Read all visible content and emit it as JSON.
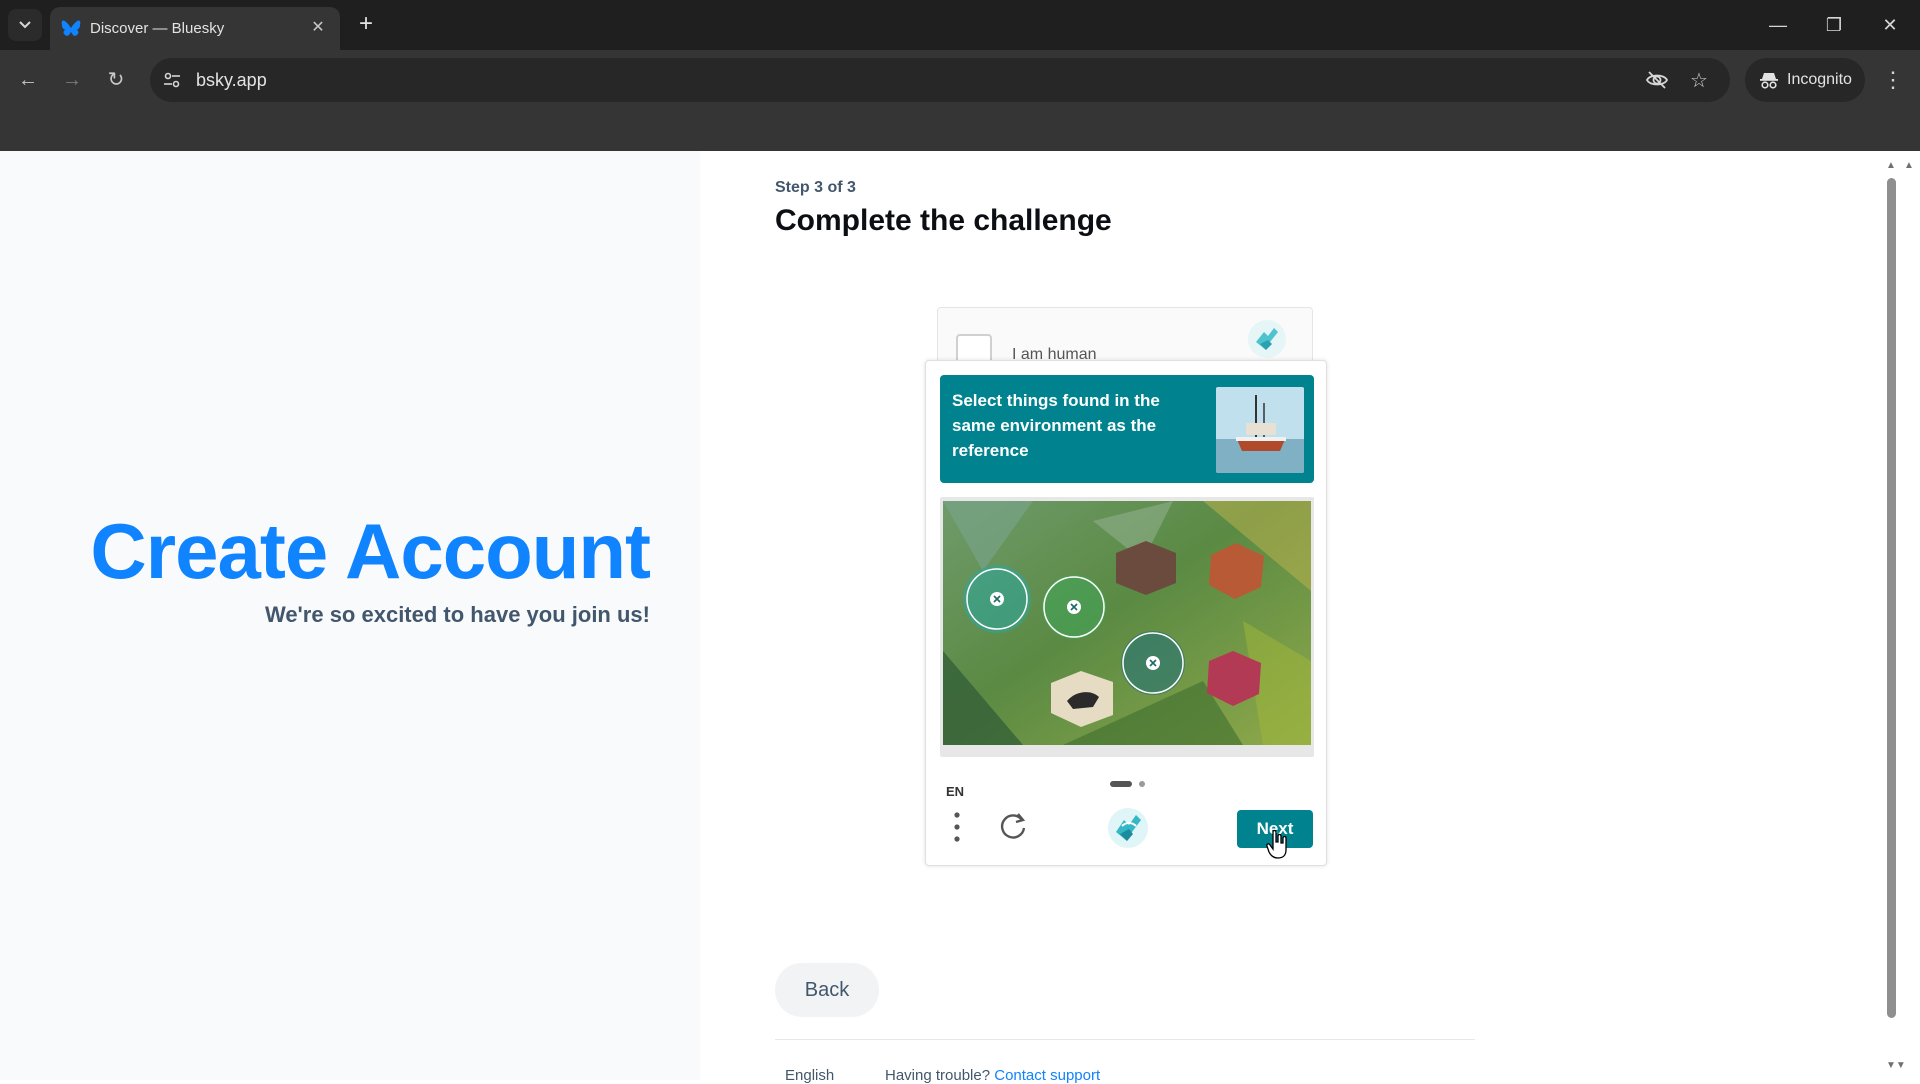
{
  "browser": {
    "tab_title": "Discover — Bluesky",
    "url": "bsky.app",
    "incognito_label": "Incognito"
  },
  "left": {
    "title": "Create Account",
    "subtitle": "We're so excited to have you join us!"
  },
  "main": {
    "step": "Step 3 of 3",
    "title": "Complete the challenge",
    "back_label": "Back"
  },
  "captcha": {
    "checkbox_label": "I am human",
    "prompt": "Select things found in the same environment as the reference",
    "language": "EN",
    "next_label": "Next",
    "page_indicator": {
      "current": 1,
      "total": 2
    },
    "colors": {
      "teal": "#00838f"
    }
  },
  "footer": {
    "language": "English",
    "help_text": "Having trouble?",
    "help_link": "Contact support"
  },
  "colors": {
    "brand_blue": "#1083fe",
    "text_muted": "#42576c"
  }
}
